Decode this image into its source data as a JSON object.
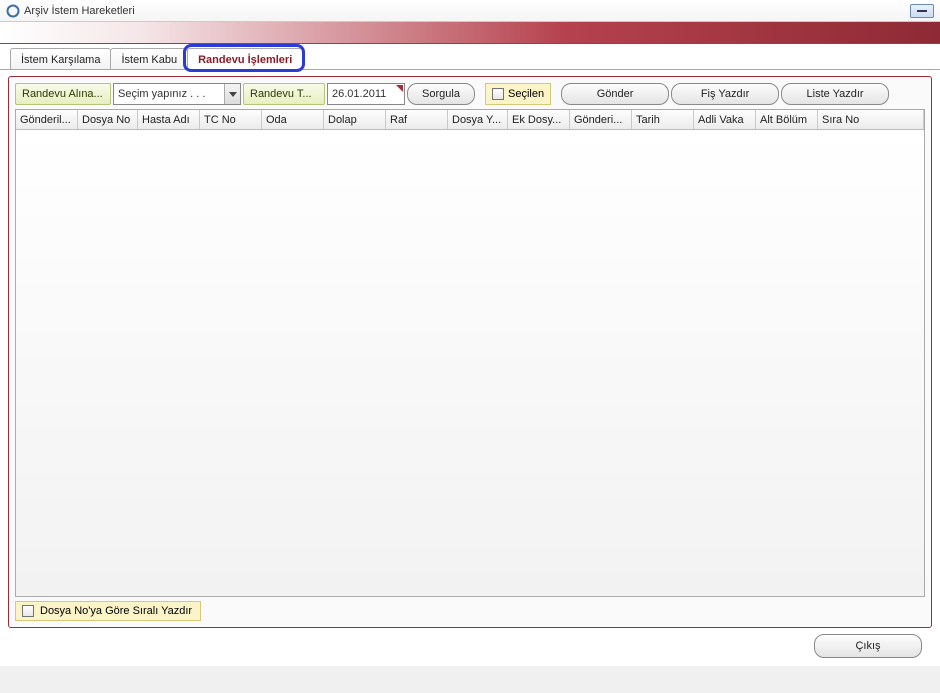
{
  "window": {
    "title": "Arşiv İstem Hareketleri"
  },
  "tabs": {
    "t0": "İstem Karşılama",
    "t1": "İstem Kabu",
    "t2": "Randevu İşlemleri"
  },
  "toolbar": {
    "label_randevu_alina": "Randevu Alına...",
    "combo_text": "Seçim yapınız . . .",
    "label_randevu_t": "Randevu T...",
    "date_value": "26.01.2011",
    "btn_sorgula": "Sorgula",
    "chk_secilen": "Seçilen",
    "btn_gonder": "Gönder",
    "btn_fis": "Fiş Yazdır",
    "btn_liste": "Liste Yazdır"
  },
  "columns": {
    "c0": "Gönderil...",
    "c1": "Dosya No",
    "c2": "Hasta Adı",
    "c3": "TC No",
    "c4": "Oda",
    "c5": "Dolap",
    "c6": "Raf",
    "c7": "Dosya Y...",
    "c8": "Ek Dosy...",
    "c9": "Gönderi...",
    "c10": "Tarih",
    "c11": "Adli Vaka",
    "c12": "Alt Bölüm",
    "c13": "Sıra No"
  },
  "bottom": {
    "chk_label": "Dosya No'ya Göre Sıralı Yazdır"
  },
  "footer": {
    "btn_exit": "Çıkış"
  }
}
